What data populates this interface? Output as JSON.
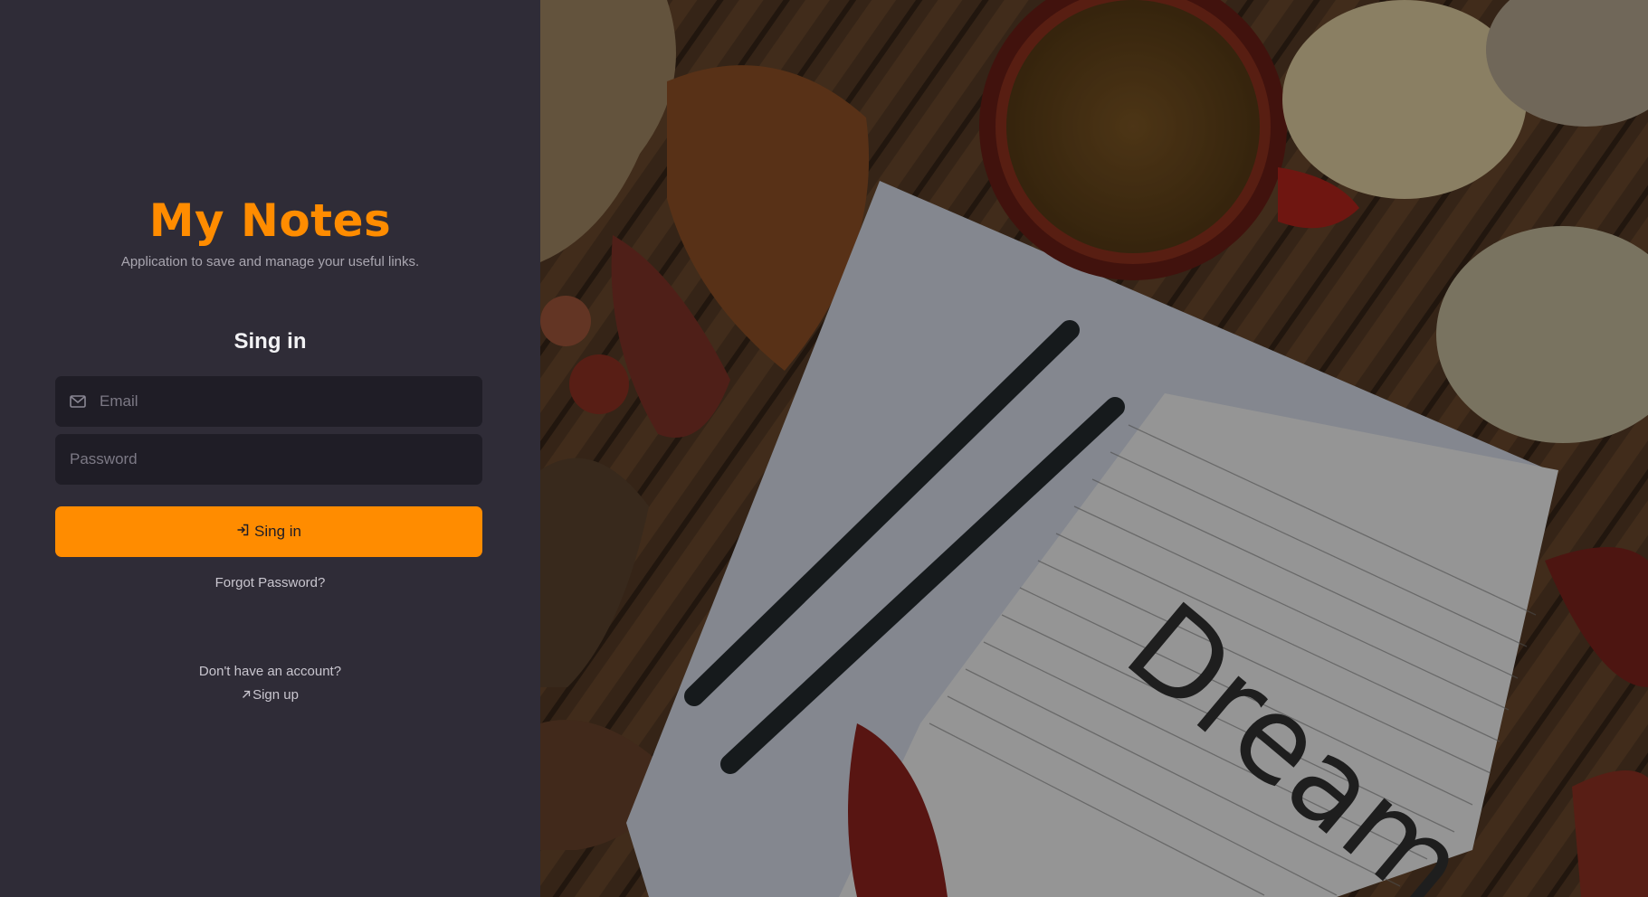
{
  "brand": {
    "title": "My Notes",
    "subtitle": "Application to save and manage your useful links."
  },
  "form": {
    "title": "Sing in",
    "email": {
      "placeholder": "Email",
      "value": "",
      "icon": "envelope-icon"
    },
    "password": {
      "placeholder": "Password",
      "value": ""
    },
    "submit_label": "Sing in",
    "submit_icon": "login-arrow-icon",
    "forgot_label": "Forgot Password?"
  },
  "signup": {
    "prompt": "Don't have an account?",
    "link_label": "Sign up",
    "link_icon": "arrow-up-right-icon"
  },
  "hero": {
    "description_icon": "photo-background",
    "notebook_text": "Dream"
  },
  "colors": {
    "accent": "#ff8c00",
    "panel": "#2f2c37",
    "field": "#1f1d26"
  }
}
